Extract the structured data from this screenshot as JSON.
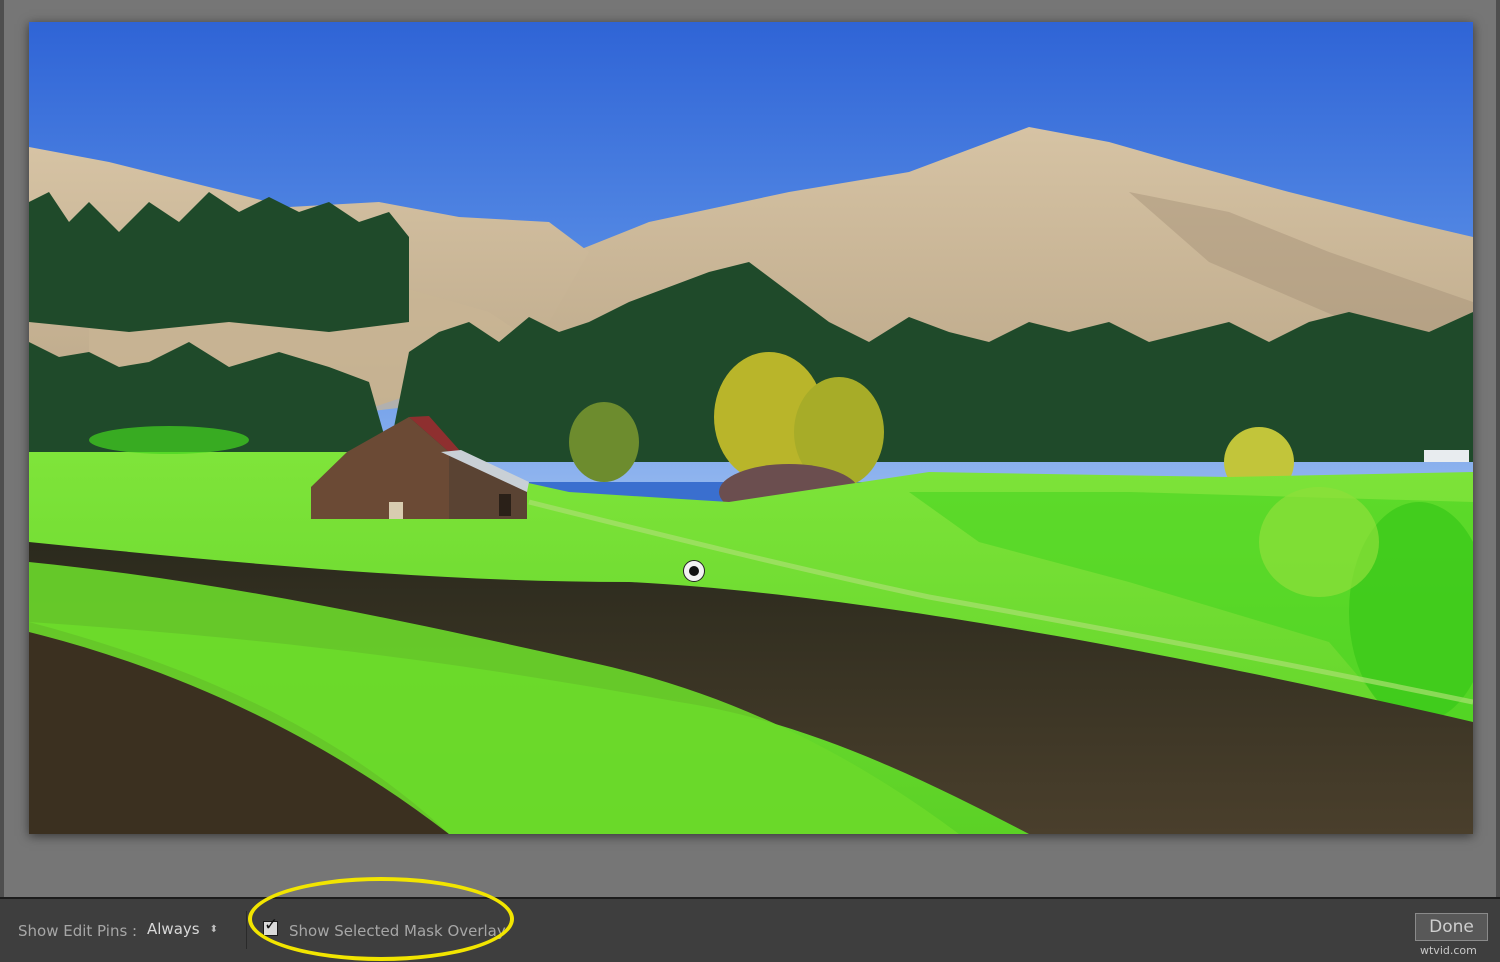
{
  "toolbar": {
    "show_edit_pins_label": "Show Edit Pins :",
    "show_edit_pins_value": "Always",
    "stepper_glyph": "⬍",
    "mask_overlay_checkbox_checked": true,
    "check_glyph": "✓",
    "mask_overlay_label": "Show Selected Mask Overlay",
    "done_label": "Done"
  },
  "photo": {
    "subject": "barn in green meadow below dry hills",
    "mask_overlay_color": "#43d41f"
  },
  "watermark": "wtvid.com",
  "colors": {
    "highlight_ring": "#f2e500",
    "toolbar_bg": "#3e3e3e",
    "workspace_bg": "#767676"
  }
}
